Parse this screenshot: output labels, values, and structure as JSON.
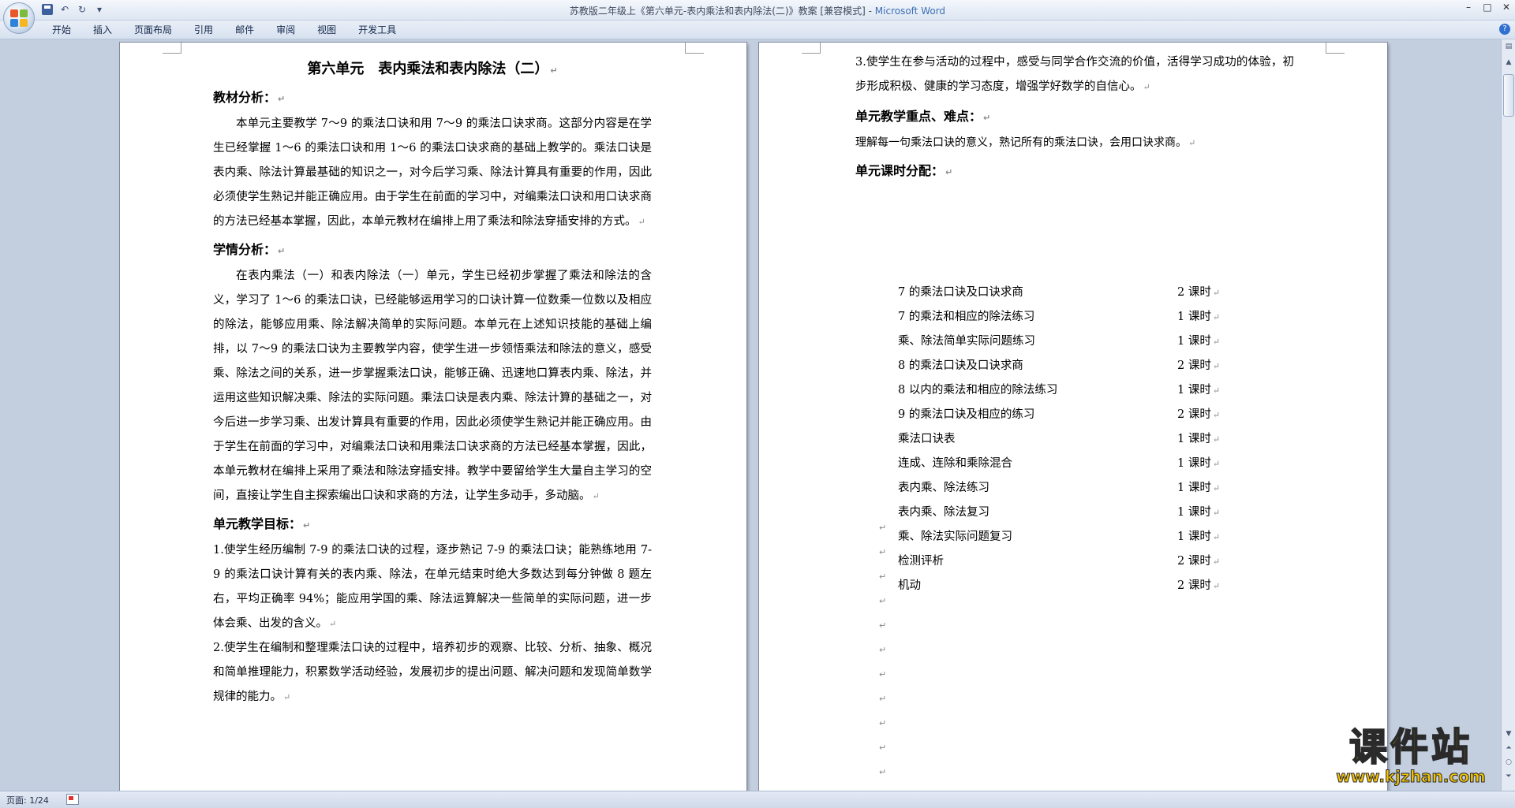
{
  "window": {
    "title": "苏教版二年级上《第六单元-表内乘法和表内除法(二)》教案 [兼容模式]",
    "app_name": "Microsoft Word"
  },
  "ribbon": {
    "tabs": [
      "开始",
      "插入",
      "页面布局",
      "引用",
      "邮件",
      "审阅",
      "视图",
      "开发工具"
    ]
  },
  "document": {
    "title": "第六单元　表内乘法和表内除法（二）",
    "sections": [
      {
        "heading": "教材分析："
      },
      {
        "heading": "学情分析："
      },
      {
        "heading": "单元教学目标："
      },
      {
        "heading": "单元教学重点、难点："
      },
      {
        "heading": "单元课时分配："
      }
    ],
    "textbook_analysis": "本单元主要教学 7～9 的乘法口诀和用 7～9 的乘法口诀求商。这部分内容是在学生已经掌握 1～6 的乘法口诀和用 1～6 的乘法口诀求商的基础上教学的。乘法口诀是表内乘、除法计算最基础的知识之一，对今后学习乘、除法计算具有重要的作用，因此必须使学生熟记并能正确应用。由于学生在前面的学习中，对编乘法口诀和用口诀求商的方法已经基本掌握，因此，本单元教材在编排上用了乘法和除法穿插安排的方式。",
    "learner_analysis": "在表内乘法（一）和表内除法（一）单元，学生已经初步掌握了乘法和除法的含义，学习了 1～6 的乘法口诀，已经能够运用学习的口诀计算一位数乘一位数以及相应的除法，能够应用乘、除法解决简单的实际问题。本单元在上述知识技能的基础上编排，以 7～9 的乘法口诀为主要教学内容，使学生进一步领悟乘法和除法的意义，感受乘、除法之间的关系，进一步掌握乘法口诀，能够正确、迅速地口算表内乘、除法，并运用这些知识解决乘、除法的实际问题。乘法口诀是表内乘、除法计算的基础之一，对今后进一步学习乘、出发计算具有重要的作用，因此必须使学生熟记并能正确应用。由于学生在前面的学习中，对编乘法口诀和用乘法口诀求商的方法已经基本掌握，因此，本单元教材在编排上采用了乘法和除法穿插安排。教学中要留给学生大量自主学习的空间，直接让学生自主探索编出口诀和求商的方法，让学生多动手，多动脑。",
    "goals": [
      "1.使学生经历编制 7-9 的乘法口诀的过程，逐步熟记 7-9 的乘法口诀；能熟练地用 7-9 的乘法口诀计算有关的表内乘、除法，在单元结束时绝大多数达到每分钟做 8 题左右，平均正确率 94%；能应用学国的乘、除法运算解决一些简单的实际问题，进一步体会乘、出发的含义。",
      "2.使学生在编制和整理乘法口诀的过程中，培养初步的观察、比较、分析、抽象、概况和简单推理能力，积累数学活动经验，发展初步的提出问题、解决问题和发现简单数学规律的能力。",
      "3.使学生在参与活动的过程中，感受与同学合作交流的价值，活得学习成功的体验，初步形成积极、健康的学习态度，增强学好数学的自信心。"
    ],
    "key_points": "理解每一句乘法口诀的意义，熟记所有的乘法口诀，会用口诀求商。",
    "schedule": [
      {
        "name": "7 的乘法口诀及口诀求商",
        "hours": "2 课时"
      },
      {
        "name": "7 的乘法和相应的除法练习",
        "hours": "1 课时"
      },
      {
        "name": "乘、除法简单实际问题练习",
        "hours": "1 课时"
      },
      {
        "name": "8 的乘法口诀及口诀求商",
        "hours": "2 课时"
      },
      {
        "name": "8 以内的乘法和相应的除法练习",
        "hours": "1 课时"
      },
      {
        "name": "9 的乘法口诀及相应的练习",
        "hours": "2 课时"
      },
      {
        "name": "乘法口诀表",
        "hours": "1 课时"
      },
      {
        "name": "连成、连除和乘除混合",
        "hours": "1 课时"
      },
      {
        "name": "表内乘、除法练习",
        "hours": "1 课时"
      },
      {
        "name": "表内乘、除法复习",
        "hours": "1 课时"
      },
      {
        "name": "乘、除法实际问题复习",
        "hours": "1 课时"
      },
      {
        "name": "检测评析",
        "hours": "2 课时"
      },
      {
        "name": "机动",
        "hours": "2 课时"
      }
    ],
    "paragraph_mark": "↵"
  },
  "status_bar": {
    "page": "页面: 1/24"
  },
  "watermark": {
    "text": "课件站",
    "url": "www.kjzhan.com"
  }
}
